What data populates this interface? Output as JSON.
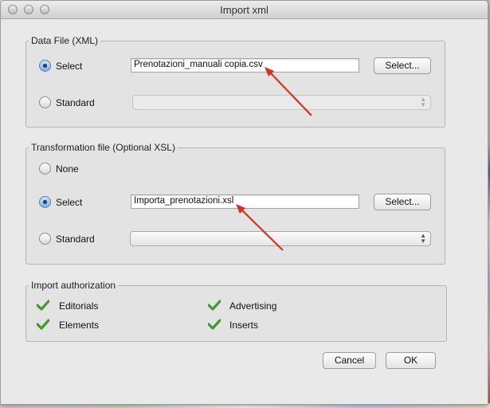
{
  "window": {
    "title": "Import xml"
  },
  "data_file": {
    "legend": "Data File (XML)",
    "select_label": "Select",
    "select_value": "Prenotazioni_manuali copia.csv",
    "select_button": "Select...",
    "standard_label": "Standard",
    "selected": "select"
  },
  "transformation": {
    "legend": "Transformation file (Optional XSL)",
    "none_label": "None",
    "select_label": "Select",
    "select_value": "Importa_prenotazioni.xsl",
    "select_button": "Select...",
    "standard_label": "Standard",
    "selected": "select"
  },
  "authorization": {
    "legend": "Import authorization",
    "items": [
      {
        "label": "Editorials",
        "checked": true
      },
      {
        "label": "Advertising",
        "checked": true
      },
      {
        "label": "Elements",
        "checked": true
      },
      {
        "label": "Inserts",
        "checked": true
      }
    ]
  },
  "buttons": {
    "cancel": "Cancel",
    "ok": "OK"
  },
  "colors": {
    "annotation_arrow": "#d9301e",
    "check": "#3d9c2c",
    "radio_selected": "#7fb0e4"
  },
  "icons": [
    "close-light-icon",
    "minimize-light-icon",
    "zoom-light-icon",
    "checkmark-icon",
    "annotation-arrow-icon"
  ]
}
